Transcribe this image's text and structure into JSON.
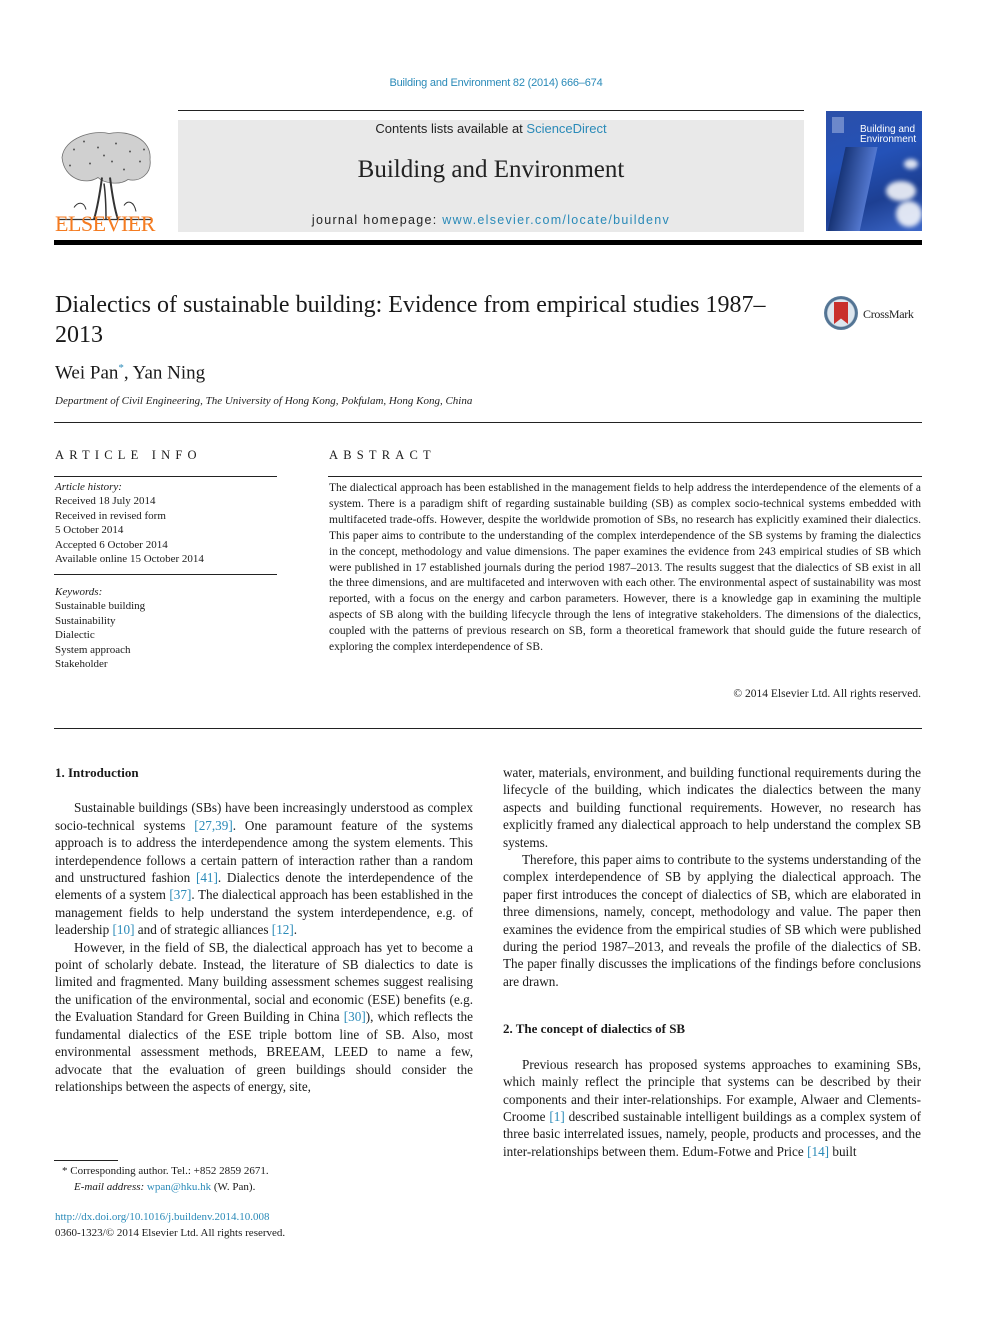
{
  "running_head": "Building and Environment 82 (2014) 666–674",
  "masthead": {
    "publisher_logo_text": "ELSEVIER",
    "contents_prefix": "Contents lists available at ",
    "contents_link": "ScienceDirect",
    "journal_name": "Building and Environment",
    "homepage_prefix": "journal homepage: ",
    "homepage_link": "www.elsevier.com/locate/buildenv",
    "cover_title_line1": "Building and",
    "cover_title_line2": "Environment"
  },
  "article": {
    "title": "Dialectics of sustainable building: Evidence from empirical studies 1987–2013",
    "crossmark_label": "CrossMark",
    "author1": "Wei Pan",
    "author1_mark": "*",
    "author_sep": ", ",
    "author2": "Yan Ning",
    "affiliation": "Department of Civil Engineering, The University of Hong Kong, Pokfulam, Hong Kong, China"
  },
  "article_info": {
    "heading": "ARTICLE INFO",
    "history_label": "Article history:",
    "history": [
      "Received 18 July 2014",
      "Received in revised form",
      "5 October 2014",
      "Accepted 6 October 2014",
      "Available online 15 October 2014"
    ],
    "keywords_label": "Keywords:",
    "keywords": [
      "Sustainable building",
      "Sustainability",
      "Dialectic",
      "System approach",
      "Stakeholder"
    ]
  },
  "abstract": {
    "heading": "ABSTRACT",
    "text": "The dialectical approach has been established in the management fields to help address the interde­pendence of the elements of a system. There is a paradigm shift of regarding sustainable building (SB) as complex socio-technical systems embedded with multifaceted trade-offs. However, despite the world­wide promotion of SBs, no research has explicitly examined their dialectics. This paper aims to contribute to the understanding of the complex interdependence of the SB systems by framing the dialectics in the concept, methodology and value dimensions. The paper examines the evidence from 243 empirical studies of SB which were published in 17 established journals during the period 1987–2013. The results suggest that the dialectics of SB exist in all the three dimensions, and are multifaceted and interwoven with each other. The environmental aspect of sustainability was most reported, with a focus on the energy and carbon parameters. However, there is a knowledge gap in examining the multiple aspects of SB along with the building lifecycle through the lens of integrative stakeholders. The dimensions of the dialectics, coupled with the patterns of previous research on SB, form a theoretical framework that should guide the future research of exploring the complex interdependence of SB.",
    "copyright": "© 2014 Elsevier Ltd. All rights reserved."
  },
  "body": {
    "section1_heading": "1.  Introduction",
    "p1": [
      {
        "t": "Sustainable buildings (SBs) have been increasingly understood as complex socio-technical systems "
      },
      {
        "c": "[27,39]"
      },
      {
        "t": ". One paramount feature of the systems approach is to address the interdependence among the system elements. This interdependence follows a certain pattern of interaction rather than a random and unstruc­tured fashion "
      },
      {
        "c": "[41]"
      },
      {
        "t": ". Dialectics denote the interdependence of the elements of a system "
      },
      {
        "c": "[37]"
      },
      {
        "t": ". The dialectical approach has been established in the management fields to help understand the system interdependence, e.g. of leadership "
      },
      {
        "c": "[10]"
      },
      {
        "t": " and of strategic alliances "
      },
      {
        "c": "[12]"
      },
      {
        "t": "."
      }
    ],
    "p2": [
      {
        "t": "However, in the field of SB, the dialectical approach has yet to become a point of scholarly debate. Instead, the literature of SB dialectics to date is limited and fragmented. Many building assessment schemes suggest realising the unification of the envi­ronmental, social and economic (ESE) benefits (e.g. the Evaluation Standard for Green Building in China "
      },
      {
        "c": "[30]"
      },
      {
        "t": "), which reflects the fundamental dialectics of the ESE triple bottom line of SB. Also, most environmental assessment methods, BREEAM, LEED to name a few, advocate that the evaluation of green buildings should consider the relationships between the aspects of energy, site,"
      }
    ],
    "p2_cont": [
      {
        "t": "water, materials, environment, and building functional re­quirements during the lifecycle of the building, which indicates the dialectics between the many aspects and building functional re­quirements. However, no research has explicitly framed any dia­lectical approach to help understand the complex SB systems."
      }
    ],
    "p3": [
      {
        "t": "Therefore, this paper aims to contribute to the systems under­standing of the complex interdependence of SB by applying the dialectical approach. The paper first introduces the concept of di­alectics of SB, which are elaborated in three dimensions, namely, concept, methodology and value. The paper then examines the evidence from the empirical studies of SB which were published during the period 1987–2013, and reveals the profile of the di­alectics of SB. The paper finally discusses the implications of the findings before conclusions are drawn."
      }
    ],
    "section2_heading": "2.  The concept of dialectics of SB",
    "p4": [
      {
        "t": "Previous research has proposed systems approaches to exam­ining SBs, which mainly reflect the principle that systems can be described by their components and their inter-relationships. For example, Alwaer and Clements-Croome "
      },
      {
        "c": "[1]"
      },
      {
        "t": " described sustainable intelligent buildings as a complex system of three basic inter­related issues, namely, people, products and processes, and the inter-relationships between them. Edum-Fotwe and Price "
      },
      {
        "c": "[14]"
      },
      {
        "t": " built"
      }
    ]
  },
  "footnotes": {
    "mark": "*",
    "corresponding": " Corresponding author. Tel.: +852 2859 2671.",
    "email_label": "E-mail address:",
    "email": "wpan@hku.hk",
    "email_suffix": " (W. Pan).",
    "doi": "http://dx.doi.org/10.1016/j.buildenv.2014.10.008",
    "issn_line": "0360-1323/© 2014 Elsevier Ltd. All rights reserved."
  },
  "colors": {
    "link": "#2a8ab8",
    "elsevier_orange": "#f47b20",
    "masthead_gray": "#e9e9e9",
    "cover_blue": "#2452b8",
    "crossmark_red": "#c9302c"
  }
}
